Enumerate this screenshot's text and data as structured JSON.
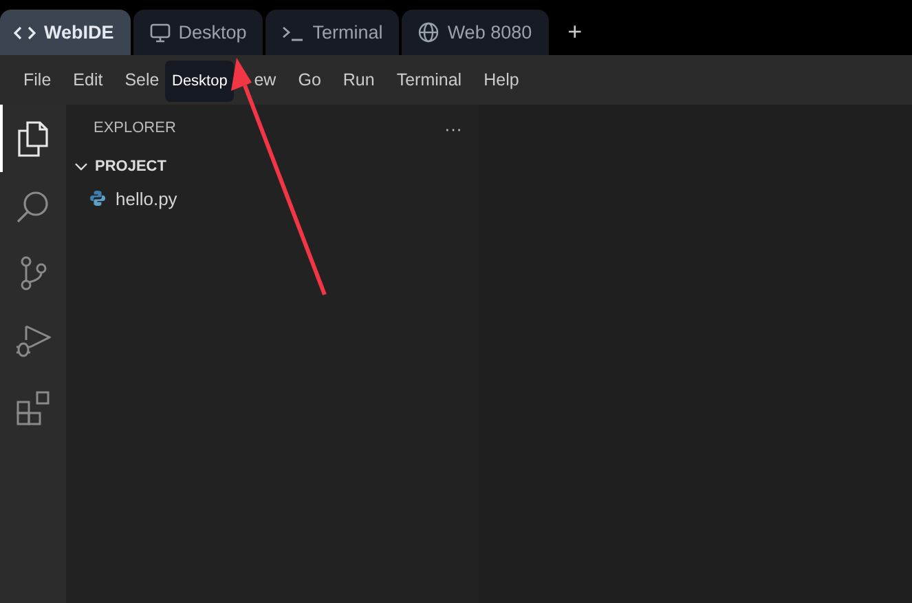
{
  "tabs": [
    {
      "label": "WebIDE",
      "kind": "code",
      "selected": true
    },
    {
      "label": "Desktop",
      "kind": "monitor",
      "selected": false
    },
    {
      "label": "Terminal",
      "kind": "terminal",
      "selected": false
    },
    {
      "label": "Web 8080",
      "kind": "globe",
      "selected": false
    }
  ],
  "new_tab": "+",
  "menu": [
    "File",
    "Edit",
    "Sele",
    "ew",
    "Go",
    "Run",
    "Terminal",
    "Help"
  ],
  "tooltip": "Desktop",
  "activity_bar": [
    {
      "kind": "files",
      "selected": true
    },
    {
      "kind": "search",
      "selected": false
    },
    {
      "kind": "source-control",
      "selected": false
    },
    {
      "kind": "run-debug",
      "selected": false
    },
    {
      "kind": "extensions",
      "selected": false
    }
  ],
  "explorer": {
    "title": "EXPLORER",
    "more": "···",
    "folder": {
      "name": "PROJECT",
      "expanded": true,
      "children": [
        {
          "name": "hello.py",
          "kind": "python"
        }
      ]
    }
  }
}
